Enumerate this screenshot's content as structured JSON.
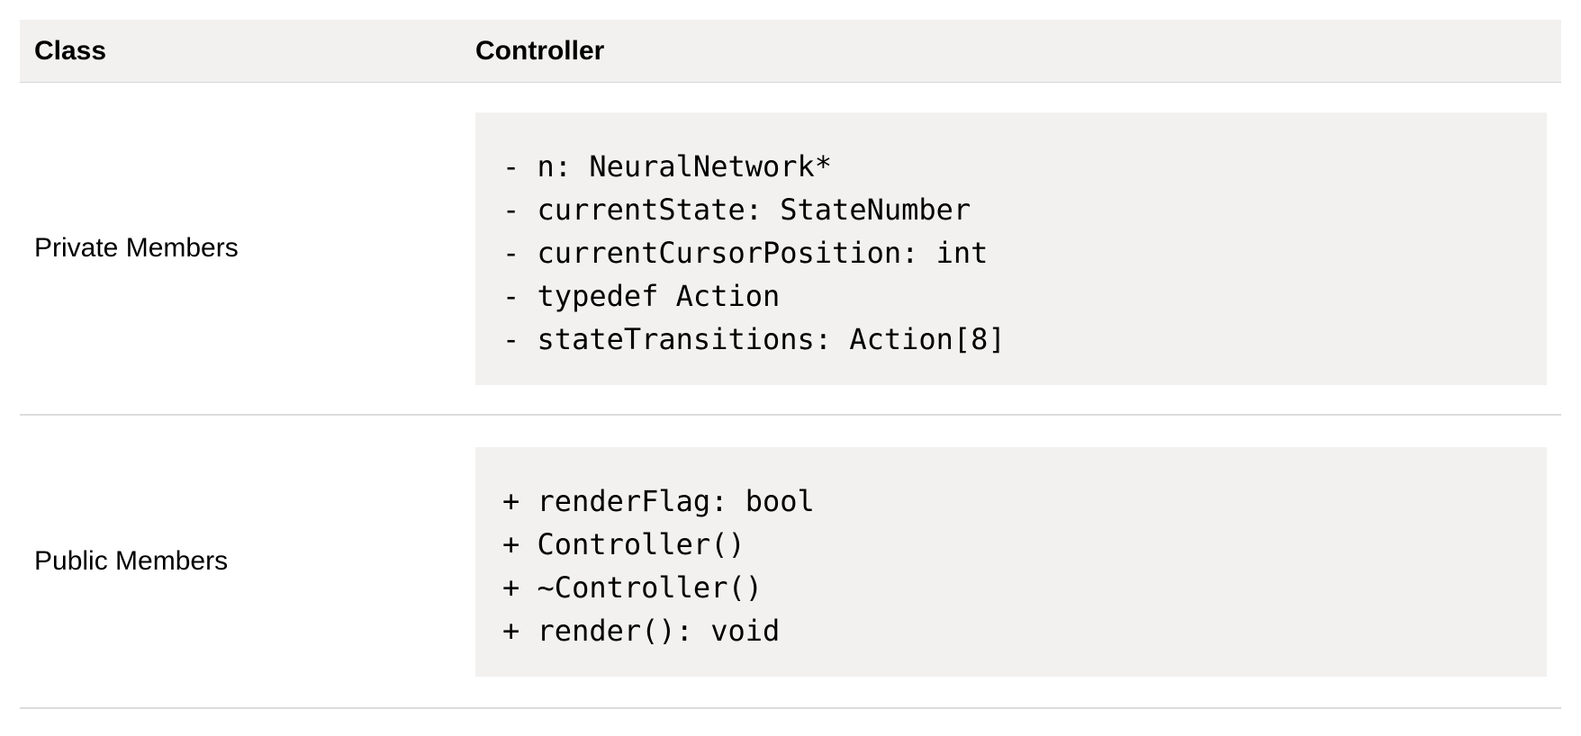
{
  "header": {
    "label": "Class",
    "value": "Controller"
  },
  "rows": [
    {
      "label": "Private Members",
      "lines": [
        "- n: NeuralNetwork*",
        "- currentState: StateNumber",
        "- currentCursorPosition: int",
        "- typedef Action",
        "- stateTransitions: Action[8]"
      ]
    },
    {
      "label": "Public Members",
      "lines": [
        "+ renderFlag: bool",
        "+ Controller()",
        "+ ~Controller()",
        "+ render(): void"
      ]
    }
  ],
  "colors": {
    "header_background": "#f2f1f0",
    "code_background": "#f2f1f0",
    "divider": "#dcdcdc"
  }
}
